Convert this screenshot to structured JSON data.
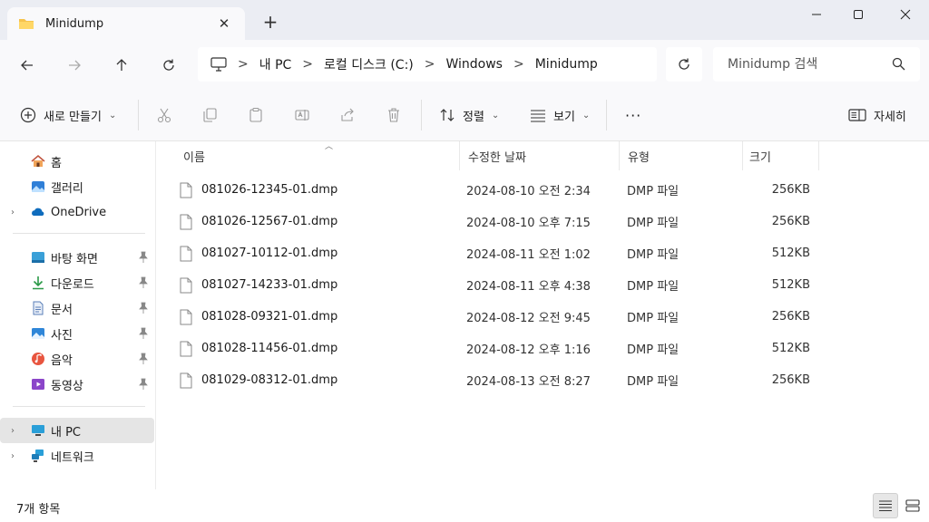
{
  "tab": {
    "title": "Minidump",
    "close": "✕",
    "new_tab": "+"
  },
  "window_controls": {
    "minimize": "minimize",
    "maximize": "maximize",
    "close": "close"
  },
  "nav": {
    "breadcrumbs": [
      "내 PC",
      "로컬 디스크 (C:)",
      "Windows",
      "Minidump"
    ],
    "separator": ">",
    "search_placeholder": "Minidump 검색"
  },
  "commands": {
    "new_label": "새로 만들기",
    "sort_label": "정렬",
    "view_label": "보기",
    "more_label": "···",
    "details_label": "자세히"
  },
  "sidebar": {
    "top_items": [
      {
        "label": "홈",
        "icon": "home-icon"
      },
      {
        "label": "갤러리",
        "icon": "gallery-icon"
      },
      {
        "label": "OneDrive",
        "icon": "onedrive-icon"
      }
    ],
    "pinned_items": [
      {
        "label": "바탕 화면",
        "icon": "desktop-icon"
      },
      {
        "label": "다운로드",
        "icon": "download-icon"
      },
      {
        "label": "문서",
        "icon": "documents-icon"
      },
      {
        "label": "사진",
        "icon": "pictures-icon"
      },
      {
        "label": "음악",
        "icon": "music-icon"
      },
      {
        "label": "동영상",
        "icon": "videos-icon"
      }
    ],
    "bottom_items": [
      {
        "label": "내 PC",
        "icon": "pc-icon",
        "selected": true
      },
      {
        "label": "네트워크",
        "icon": "network-icon"
      }
    ]
  },
  "table": {
    "columns": [
      "이름",
      "수정한 날짜",
      "유형",
      "크기"
    ],
    "rows": [
      {
        "name": "081026-12345-01.dmp",
        "date": "2024-08-10 오전 2:34",
        "type": "DMP 파일",
        "size": "256KB"
      },
      {
        "name": "081026-12567-01.dmp",
        "date": "2024-08-10 오후 7:15",
        "type": "DMP 파일",
        "size": "256KB"
      },
      {
        "name": "081027-10112-01.dmp",
        "date": "2024-08-11 오전 1:02",
        "type": "DMP 파일",
        "size": "512KB"
      },
      {
        "name": "081027-14233-01.dmp",
        "date": "2024-08-11 오후 4:38",
        "type": "DMP 파일",
        "size": "512KB"
      },
      {
        "name": "081028-09321-01.dmp",
        "date": "2024-08-12 오전 9:45",
        "type": "DMP 파일",
        "size": "256KB"
      },
      {
        "name": "081028-11456-01.dmp",
        "date": "2024-08-12 오후 1:16",
        "type": "DMP 파일",
        "size": "512KB"
      },
      {
        "name": "081029-08312-01.dmp",
        "date": "2024-08-13 오전 8:27",
        "type": "DMP 파일",
        "size": "256KB"
      }
    ]
  },
  "status": {
    "item_count": "7개 항목"
  },
  "colors": {
    "titlebar": "#ebedf3",
    "toolbar": "#f9f9fb",
    "folder": "#f6c34c",
    "accent": "#0067c0"
  }
}
